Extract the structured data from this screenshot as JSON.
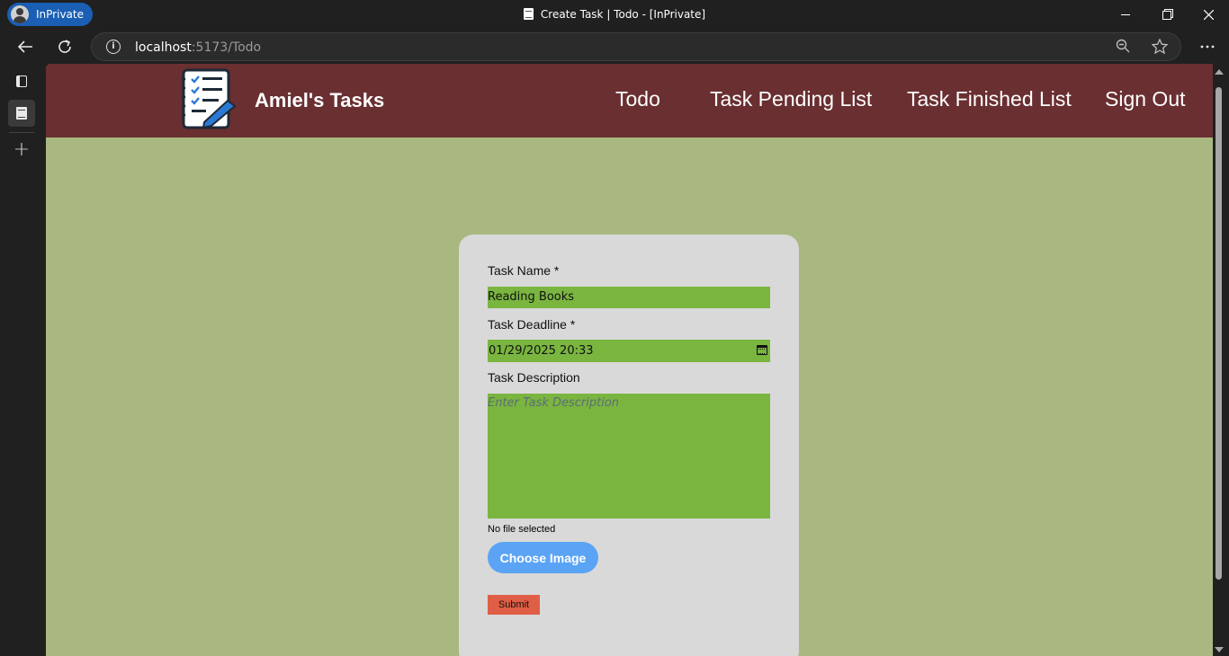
{
  "browser": {
    "inprivate_label": "InPrivate",
    "window_title": "Create Task | Todo - [InPrivate]",
    "url_host": "localhost",
    "url_rest": ":5173/Todo"
  },
  "header": {
    "brand": "Amiel's Tasks",
    "menu": [
      {
        "label": "Todo"
      },
      {
        "label": "Task Pending List"
      },
      {
        "label": "Task Finished List"
      },
      {
        "label": "Sign Out"
      }
    ],
    "colors": {
      "header_bg": "#6a2f31",
      "page_bg": "#a8b880"
    }
  },
  "form": {
    "task_name_label": "Task Name *",
    "task_name_value": "Reading Books",
    "deadline_label": "Task Deadline *",
    "deadline_value": "01/29/2025 20:33",
    "description_label": "Task Description",
    "description_placeholder": "Enter Task Description",
    "file_status": "No file selected",
    "choose_image_label": "Choose Image",
    "submit_label": "Submit",
    "colors": {
      "field_bg": "#7ab540",
      "choose_btn": "#5ba4f5",
      "submit_btn": "#e05e45",
      "card_bg": "#d9d9d9"
    }
  }
}
